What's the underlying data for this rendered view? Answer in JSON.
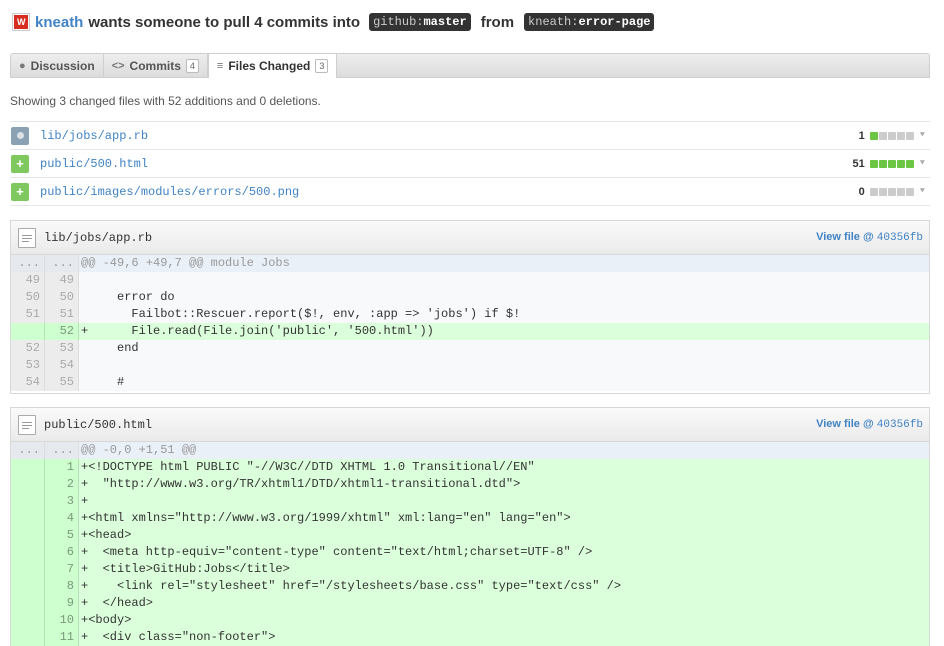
{
  "header": {
    "user": "kneath",
    "text": "wants someone to pull 4 commits into",
    "base_prefix": "github:",
    "base_branch": "master",
    "from": "from",
    "head_prefix": "kneath:",
    "head_branch": "error-page"
  },
  "tabs": [
    {
      "label": "Discussion",
      "icon": "chat-bubble-icon",
      "count": ""
    },
    {
      "label": "Commits",
      "icon": "code-brackets-icon",
      "count": "4"
    },
    {
      "label": "Files Changed",
      "icon": "file-diff-icon",
      "count": "3"
    }
  ],
  "summary": "Showing 3 changed files with 52 additions and 0 deletions.",
  "files": [
    {
      "name": "lib/jobs/app.rb",
      "status": "modified",
      "count": "1",
      "green": 1
    },
    {
      "name": "public/500.html",
      "status": "added",
      "count": "51",
      "green": 5
    },
    {
      "name": "public/images/modules/errors/500.png",
      "status": "added",
      "count": "0",
      "green": 0
    }
  ],
  "diffs": [
    {
      "name": "lib/jobs/app.rb",
      "view_label": "View file @",
      "sha": "40356fb",
      "lines": [
        {
          "type": "hunk",
          "old": "...",
          "new": "...",
          "code": "@@ -49,6 +49,7 @@ module Jobs"
        },
        {
          "type": "ctx",
          "old": "49",
          "new": "49",
          "code": " "
        },
        {
          "type": "ctx",
          "old": "50",
          "new": "50",
          "code": "     error do"
        },
        {
          "type": "ctx",
          "old": "51",
          "new": "51",
          "code": "       Failbot::Rescuer.report($!, env, :app => 'jobs') if $!"
        },
        {
          "type": "add",
          "old": "",
          "new": "52",
          "code": "+      File.read(File.join('public', '500.html'))"
        },
        {
          "type": "ctx",
          "old": "52",
          "new": "53",
          "code": "     end"
        },
        {
          "type": "ctx",
          "old": "53",
          "new": "54",
          "code": " "
        },
        {
          "type": "ctx",
          "old": "54",
          "new": "55",
          "code": "     #"
        }
      ]
    },
    {
      "name": "public/500.html",
      "view_label": "View file @",
      "sha": "40356fb",
      "lines": [
        {
          "type": "hunk",
          "old": "...",
          "new": "...",
          "code": "@@ -0,0 +1,51 @@"
        },
        {
          "type": "add",
          "old": "",
          "new": "1",
          "code": "+<!DOCTYPE html PUBLIC \"-//W3C//DTD XHTML 1.0 Transitional//EN\""
        },
        {
          "type": "add",
          "old": "",
          "new": "2",
          "code": "+  \"http://www.w3.org/TR/xhtml1/DTD/xhtml1-transitional.dtd\">"
        },
        {
          "type": "add",
          "old": "",
          "new": "3",
          "code": "+"
        },
        {
          "type": "add",
          "old": "",
          "new": "4",
          "code": "+<html xmlns=\"http://www.w3.org/1999/xhtml\" xml:lang=\"en\" lang=\"en\">"
        },
        {
          "type": "add",
          "old": "",
          "new": "5",
          "code": "+<head>"
        },
        {
          "type": "add",
          "old": "",
          "new": "6",
          "code": "+  <meta http-equiv=\"content-type\" content=\"text/html;charset=UTF-8\" />"
        },
        {
          "type": "add",
          "old": "",
          "new": "7",
          "code": "+  <title>GitHub:Jobs</title>"
        },
        {
          "type": "add",
          "old": "",
          "new": "8",
          "code": "+    <link rel=\"stylesheet\" href=\"/stylesheets/base.css\" type=\"text/css\" />"
        },
        {
          "type": "add",
          "old": "",
          "new": "9",
          "code": "+  </head>"
        },
        {
          "type": "add",
          "old": "",
          "new": "10",
          "code": "+<body>"
        },
        {
          "type": "add",
          "old": "",
          "new": "11",
          "code": "+  <div class=\"non-footer\">"
        }
      ]
    }
  ]
}
